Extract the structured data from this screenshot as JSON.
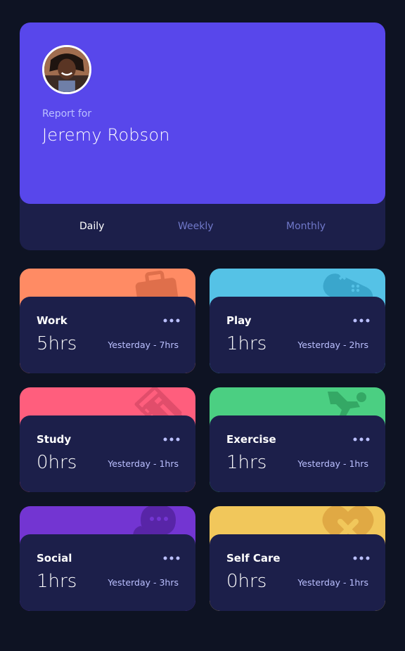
{
  "profile": {
    "report_for": "Report for",
    "name": "Jeremy Robson"
  },
  "tabs": [
    {
      "label": "Daily",
      "active": true
    },
    {
      "label": "Weekly",
      "active": false
    },
    {
      "label": "Monthly",
      "active": false
    }
  ],
  "activities": [
    {
      "title": "Work",
      "current": "5hrs",
      "previous": "Yesterday - 7hrs",
      "color": "#ff8b64",
      "icon": "briefcase-icon"
    },
    {
      "title": "Play",
      "current": "1hrs",
      "previous": "Yesterday - 2hrs",
      "color": "#55c2e6",
      "icon": "gamepad-icon"
    },
    {
      "title": "Study",
      "current": "0hrs",
      "previous": "Yesterday - 1hrs",
      "color": "#ff5e7d",
      "icon": "books-icon"
    },
    {
      "title": "Exercise",
      "current": "1hrs",
      "previous": "Yesterday - 1hrs",
      "color": "#4bcf82",
      "icon": "runner-icon"
    },
    {
      "title": "Social",
      "current": "1hrs",
      "previous": "Yesterday - 3hrs",
      "color": "#7335d2",
      "icon": "chat-icon"
    },
    {
      "title": "Self Care",
      "current": "0hrs",
      "previous": "Yesterday - 1hrs",
      "color": "#f1c75b",
      "icon": "heart-icon"
    }
  ],
  "colors": {
    "background": "#0e1323",
    "card": "#1c1f4a",
    "accent": "#5847eb",
    "muted_text": "#bbc0ff",
    "tab_inactive": "#7078c9"
  }
}
